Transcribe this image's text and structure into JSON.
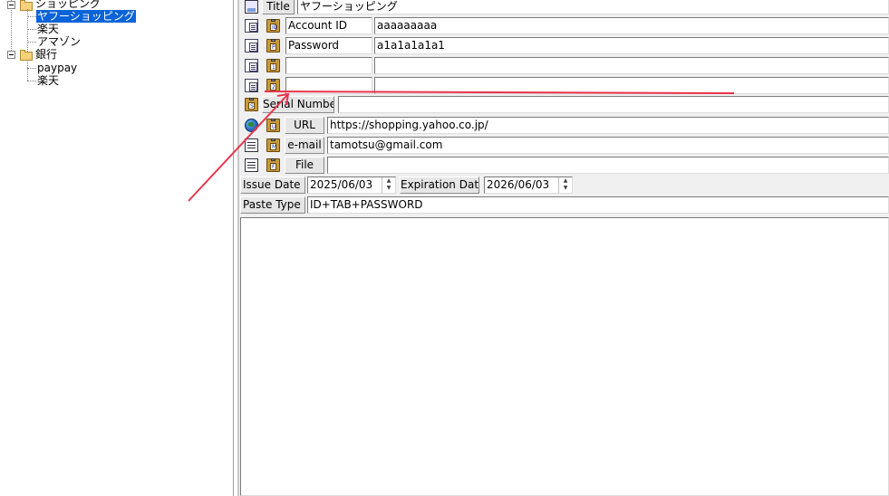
{
  "tree": {
    "items": [
      {
        "label": "ショッピング",
        "type": "folder"
      },
      {
        "label": "ヤフーショッピング",
        "selected": true
      },
      {
        "label": "楽天"
      },
      {
        "label": "アマゾン"
      },
      {
        "label": "銀行",
        "type": "folder"
      },
      {
        "label": "paypay"
      },
      {
        "label": "楽天"
      }
    ]
  },
  "form": {
    "title_label": "Title",
    "title_value": "ヤフーショッピング",
    "account_id_label": "Account ID",
    "account_id_value": "aaaaaaaaa",
    "password_label": "Password",
    "password_value": "a1a1a1a1a1",
    "extra1_label": "",
    "extra1_value": "",
    "extra2_label": "",
    "extra2_value": "",
    "serial_label": "Serial Number",
    "serial_value": "",
    "url_label": "URL",
    "url_value": "https://shopping.yahoo.co.jp/",
    "email_label": "e-mail",
    "email_value": "tamotsu@gmail.com",
    "file_label": "File",
    "file_value": "",
    "issue_date_label": "Issue Date",
    "issue_date_value": "2025/06/03",
    "expiration_date_label": "Expiration Date",
    "expiration_date_value": "2026/06/03",
    "paste_type_label": "Paste Type",
    "paste_type_value": "ID+TAB+PASSWORD",
    "memo_value": ""
  },
  "icons": {
    "row_copy": "copy-icon",
    "row_paste": "clipboard-icon",
    "url_icon": "globe-icon",
    "email_icon": "list-icon",
    "file_icon": "file-list-icon",
    "title_icon": "id-card-icon"
  },
  "colors": {
    "selection": "#0a64d8",
    "annotation_arrow": "#e8344a",
    "panel_bg": "#f0f0f0"
  }
}
